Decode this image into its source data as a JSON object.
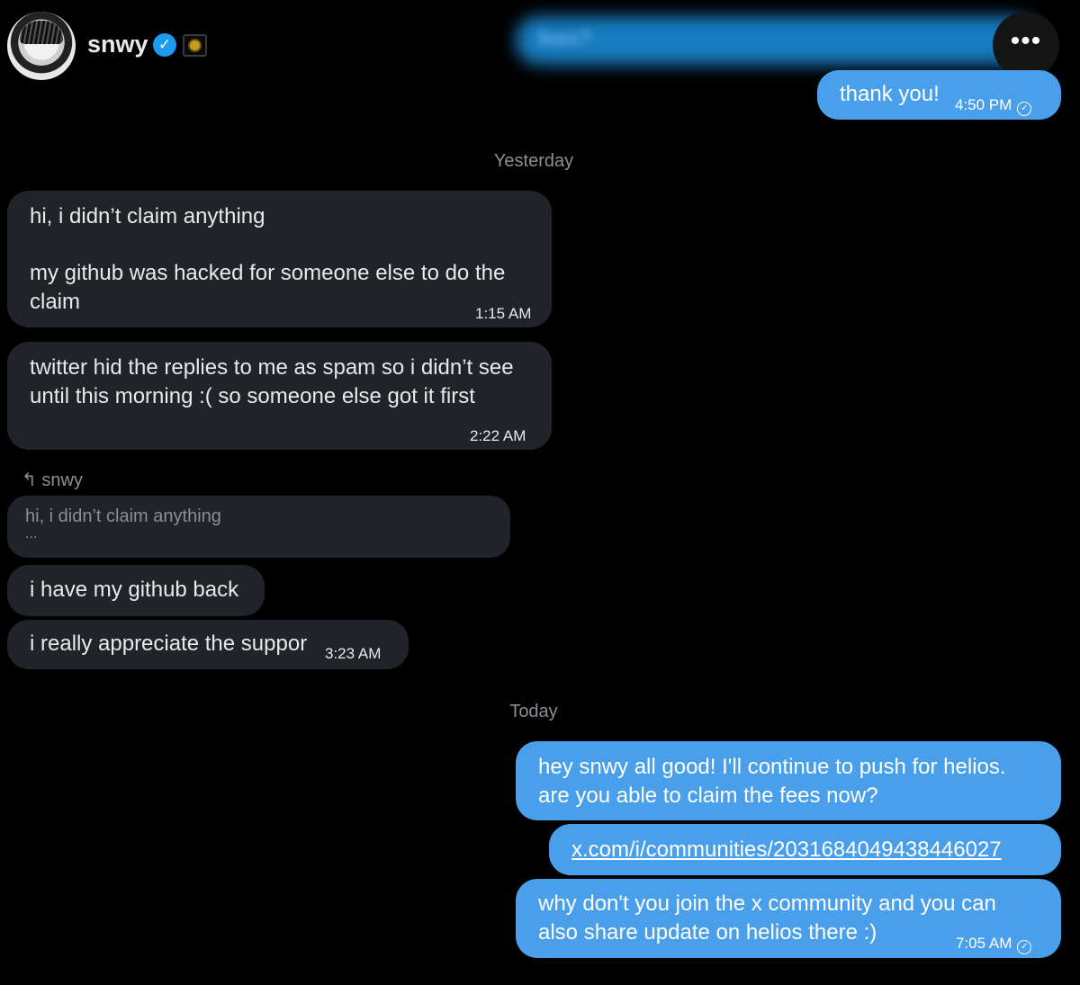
{
  "header": {
    "username": "snwy",
    "avatar_icon": "anime-avatar-icon",
    "verified_icon": "verified-badge-icon",
    "affiliate_icon": "affiliate-badge-icon",
    "more_label": "•••",
    "blurred_prev_message": "fees?"
  },
  "messages_top": {
    "thank_you": {
      "text": "thank you!",
      "time": "4:50 PM"
    }
  },
  "separators": {
    "yesterday": "Yesterday",
    "today": "Today"
  },
  "yesterday_messages": [
    {
      "p1": "hi, i didn’t claim anything",
      "p2": "my github was hacked for someone else to do the claim",
      "time": "1:15 AM"
    },
    {
      "text": "twitter hid the replies to me as spam so i didn’t see until this morning :( so someone else got it first",
      "time": "2:22 AM"
    }
  ],
  "reply": {
    "label": "snwy",
    "quote": "hi, i didn’t claim anything",
    "ellipsis": "..."
  },
  "reply_messages": [
    {
      "text": "i have my github back"
    },
    {
      "text": "i really appreciate the suppor",
      "time": "3:23 AM"
    }
  ],
  "today_messages": [
    {
      "text": "hey snwy all good! I'll continue to push for helios. are you able to claim the fees now?"
    },
    {
      "text": "x.com/i/communities/2031684049438446027"
    },
    {
      "text": "why don't you join the x community and you can also share update on helios there :)",
      "time": "7:05 AM"
    }
  ],
  "colors": {
    "outgoing": "#4a9fea",
    "incoming": "#202327",
    "background": "#000000",
    "accent": "#1d9bf0"
  }
}
